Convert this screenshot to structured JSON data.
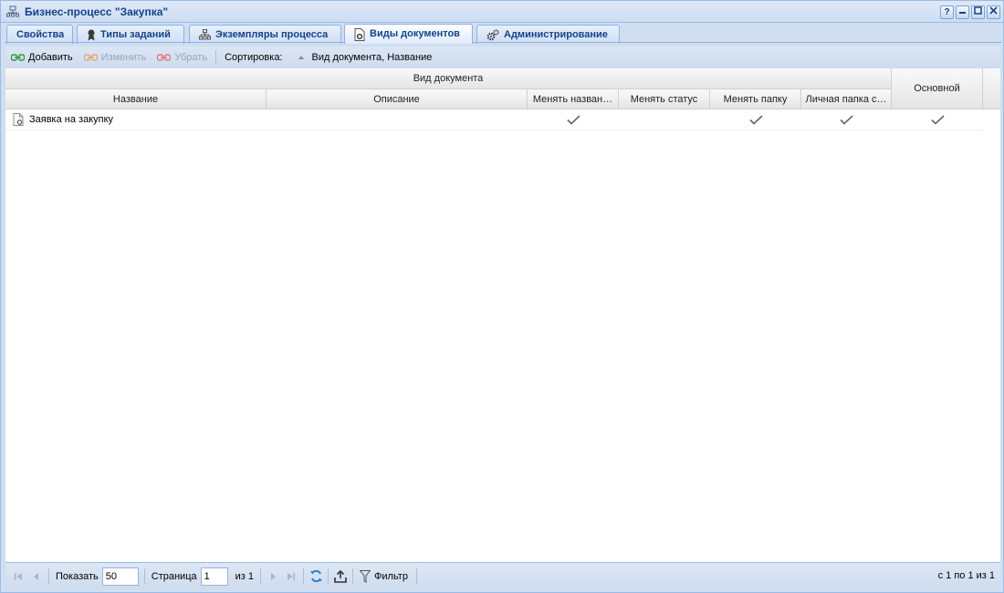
{
  "window": {
    "title": "Бизнес-процесс \"Закупка\"",
    "buttons": [
      "?",
      "–",
      "□",
      "✕"
    ]
  },
  "tabs": [
    {
      "label": "Свойства",
      "icon": "none"
    },
    {
      "label": "Типы заданий",
      "icon": "award-icon"
    },
    {
      "label": "Экземпляры процесса",
      "icon": "hierarchy-icon"
    },
    {
      "label": "Виды документов",
      "icon": "document-gear-icon",
      "active": true
    },
    {
      "label": "Администрирование",
      "icon": "gears-icon"
    }
  ],
  "toolbar": {
    "add_label": "Добавить",
    "edit_label": "Изменить",
    "remove_label": "Убрать",
    "sort_label": "Сортировка:",
    "sort_value": "Вид документа, Название"
  },
  "grid": {
    "group_header": "Вид документа",
    "columns": [
      "Название",
      "Описание",
      "Менять назван…",
      "Менять статус",
      "Менять папку",
      "Личная папка с…"
    ],
    "main_column": "Основной",
    "rows": [
      {
        "name": "Заявка на закупку",
        "description": "",
        "change_name": true,
        "change_status": false,
        "change_folder": true,
        "personal_folder": true,
        "main": true
      }
    ]
  },
  "paging": {
    "show_label": "Показать",
    "page_size": "50",
    "page_label": "Страница",
    "page_value": "1",
    "of_label": "из 1",
    "filter_label": "Фильтр",
    "summary": "с 1 по 1 из 1"
  },
  "colors": {
    "accent": "#15428b",
    "frame": "#99bbe8",
    "panel": "#d0def0"
  }
}
